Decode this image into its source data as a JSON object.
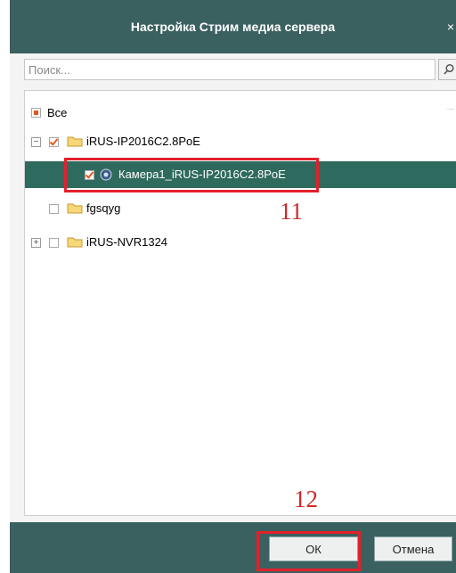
{
  "dialog": {
    "title": "Настройка Стрим медиа сервера",
    "close_glyph": "×"
  },
  "search": {
    "placeholder": "Поиск...",
    "value": "",
    "button_icon": "search-icon"
  },
  "tree": {
    "root": {
      "label": "Все",
      "check_state": "partial"
    },
    "items": [
      {
        "label": "iRUS-IP2016C2.8PoE",
        "expander": "−",
        "checked": true,
        "icon": "folder-icon"
      },
      {
        "label": "Камера1_iRUS-IP2016C2.8PoE",
        "checked": true,
        "icon": "camera-icon",
        "selected": true
      },
      {
        "label": "fgsqyg",
        "checked": false,
        "icon": "folder-icon"
      },
      {
        "label": "iRUS-NVR1324",
        "expander": "+",
        "checked": false,
        "icon": "folder-icon"
      }
    ]
  },
  "annotations": {
    "step_11": "11",
    "step_12": "12"
  },
  "footer": {
    "ok_label": "ОК",
    "cancel_label": "Отмена"
  },
  "colors": {
    "titlebar": "#3b6060",
    "selection": "#2f6a5e",
    "annotation": "#e4202a",
    "checkmark": "#e05a20"
  }
}
